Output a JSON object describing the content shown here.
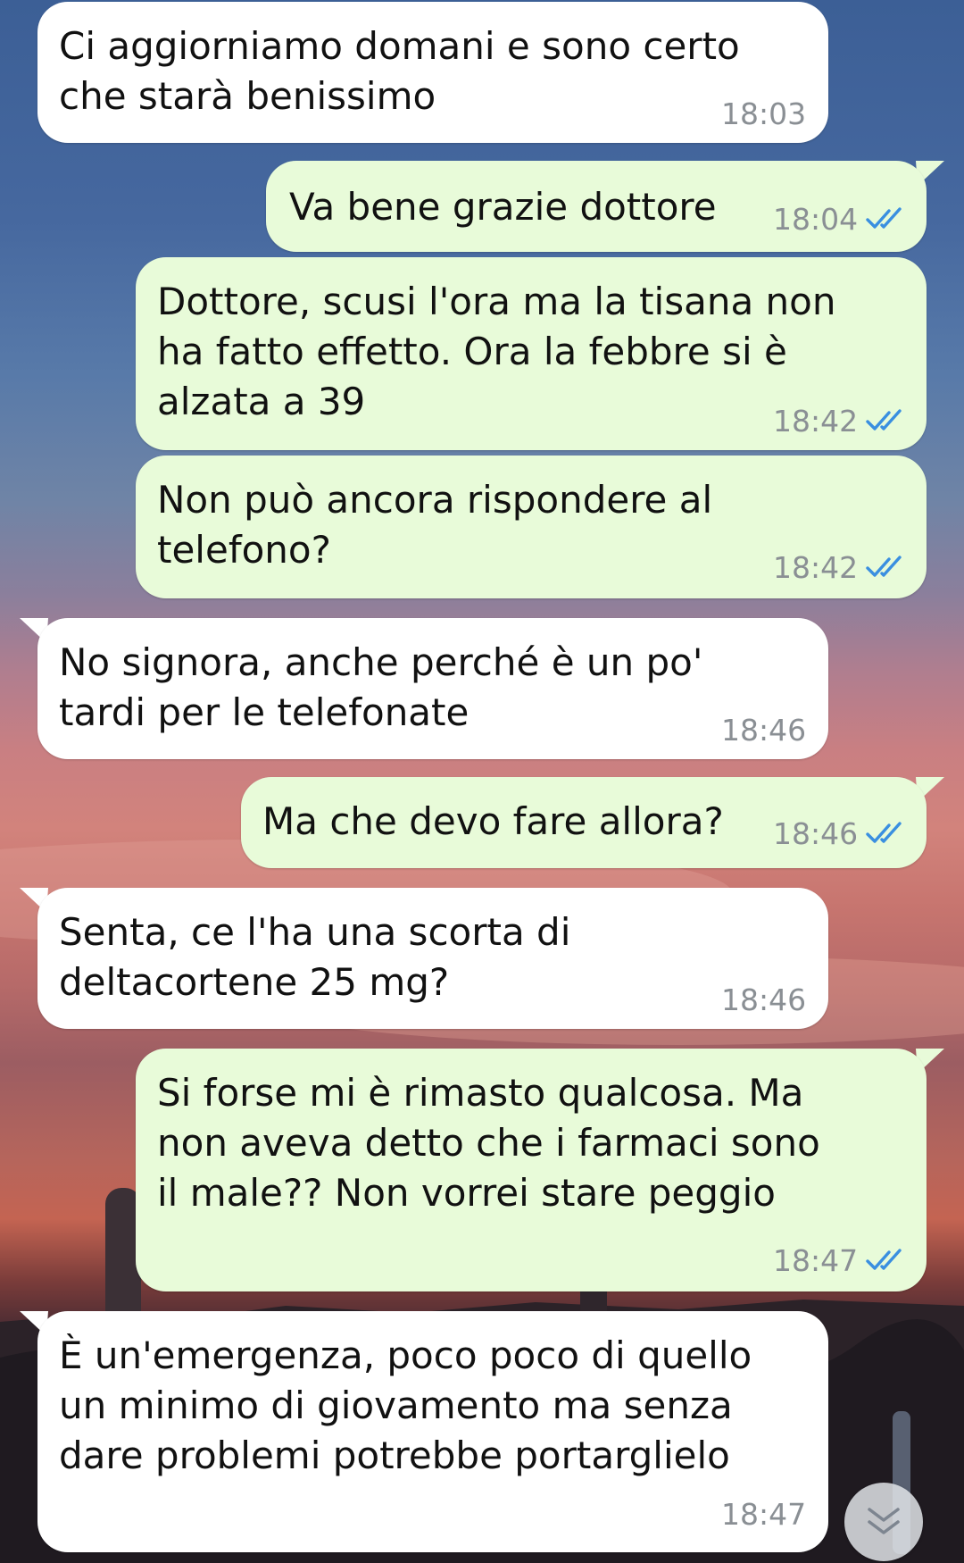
{
  "colors": {
    "incoming_bubble": "#ffffff",
    "outgoing_bubble": "#e8fbd9",
    "timestamp": "#8a8f94",
    "read_ticks": "#3a8fe0"
  },
  "messages": [
    {
      "direction": "in",
      "text": "Ci aggiorniamo domani e sono certo\nche starà benissimo",
      "time": "18:03",
      "status": ""
    },
    {
      "direction": "out",
      "text": "Va bene grazie dottore",
      "time": "18:04",
      "status": "read"
    },
    {
      "direction": "out",
      "text": "Dottore, scusi l'ora ma la tisana non\nha fatto effetto. Ora la febbre si è\nalzata a 39",
      "time": "18:42",
      "status": "read"
    },
    {
      "direction": "out",
      "text": "Non può ancora rispondere al\ntelefono?",
      "time": "18:42",
      "status": "read"
    },
    {
      "direction": "in",
      "text": "No signora, anche perché è un po'\ntardi per le telefonate",
      "time": "18:46",
      "status": ""
    },
    {
      "direction": "out",
      "text": "Ma che devo fare allora?",
      "time": "18:46",
      "status": "read"
    },
    {
      "direction": "in",
      "text": "Senta, ce l'ha una scorta di\ndeltacortene 25 mg?",
      "time": "18:46",
      "status": ""
    },
    {
      "direction": "out",
      "text": "Si forse mi è rimasto qualcosa. Ma\nnon aveva detto che i farmaci sono\nil male?? Non vorrei stare peggio",
      "time": "18:47",
      "status": "read"
    },
    {
      "direction": "in",
      "text": "È un'emergenza, poco poco di quello\nun minimo di giovamento ma senza\ndare problemi potrebbe portarglielo",
      "time": "18:47",
      "status": ""
    }
  ],
  "scroll_button_icon": "double-chevron-down-icon"
}
